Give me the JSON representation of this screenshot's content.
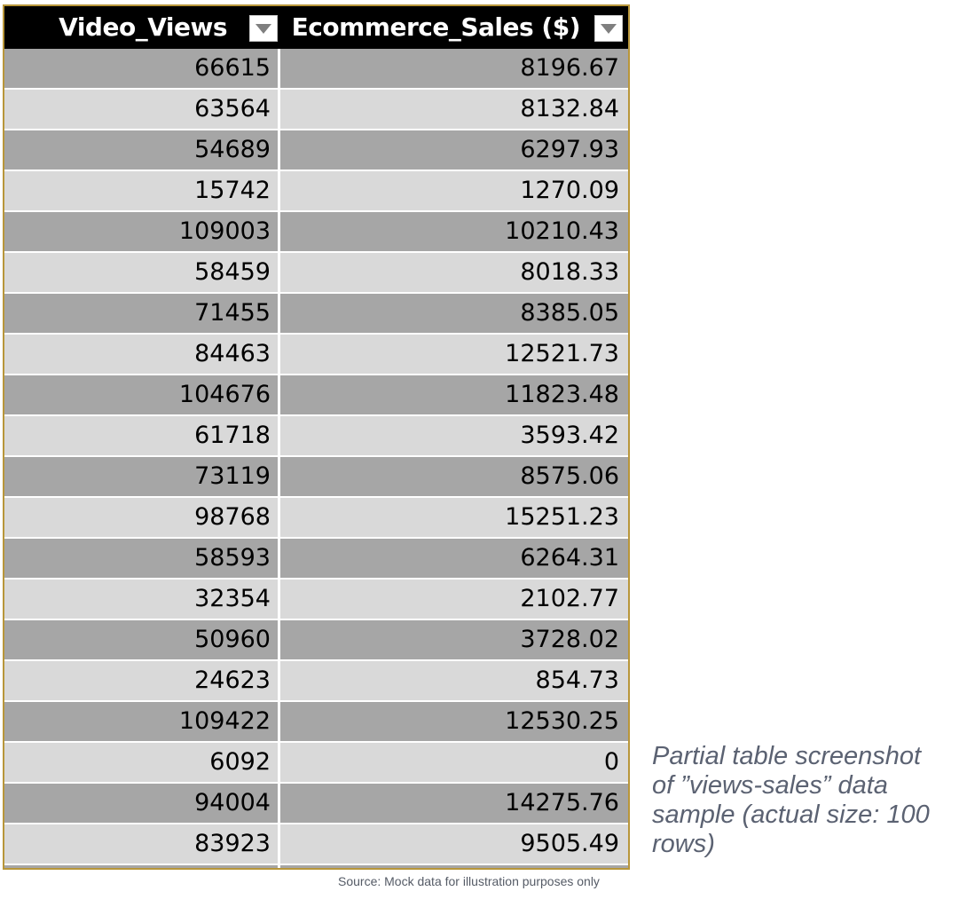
{
  "table": {
    "columns": [
      {
        "label": "Video_Views",
        "filter_icon": "dropdown-arrow-icon"
      },
      {
        "label": "Ecommerce_Sales ($)",
        "filter_icon": "dropdown-arrow-icon"
      }
    ],
    "rows": [
      [
        "66615",
        "8196.67"
      ],
      [
        "63564",
        "8132.84"
      ],
      [
        "54689",
        "6297.93"
      ],
      [
        "15742",
        "1270.09"
      ],
      [
        "109003",
        "10210.43"
      ],
      [
        "58459",
        "8018.33"
      ],
      [
        "71455",
        "8385.05"
      ],
      [
        "84463",
        "12521.73"
      ],
      [
        "104676",
        "11823.48"
      ],
      [
        "61718",
        "3593.42"
      ],
      [
        "73119",
        "8575.06"
      ],
      [
        "98768",
        "15251.23"
      ],
      [
        "58593",
        "6264.31"
      ],
      [
        "32354",
        "2102.77"
      ],
      [
        "50960",
        "3728.02"
      ],
      [
        "24623",
        "854.73"
      ],
      [
        "109422",
        "12530.25"
      ],
      [
        "6092",
        "0"
      ],
      [
        "94004",
        "14275.76"
      ],
      [
        "83923",
        "9505.49"
      ]
    ]
  },
  "caption": "Partial table screenshot of ”views-sales” data sample (actual size: 100 rows)",
  "source_note": "Source: Mock data for illustration purposes only",
  "colors": {
    "header_bg": "#000000",
    "row_dark": "#a6a6a6",
    "row_light": "#d9d9d9",
    "frame_border": "#b8963a",
    "caption_text": "#5b6272"
  }
}
